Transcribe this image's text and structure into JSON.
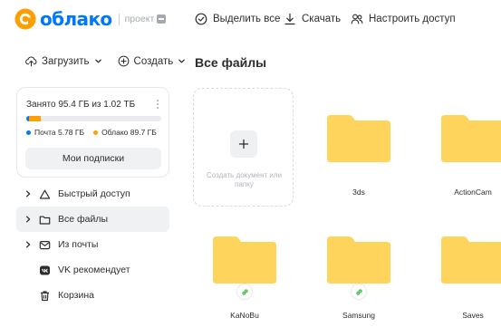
{
  "brand": {
    "name": "облако",
    "subtitle": "проект",
    "color": "#0077ff"
  },
  "toolbar": {
    "select_all": "Выделить все",
    "download": "Скачать",
    "access": "Настроить доступ"
  },
  "sidebar": {
    "upload_label": "Загрузить",
    "create_label": "Создать",
    "storage": {
      "used_label": "Занято 95.4 ГБ из 1.02 ТБ",
      "mail_label": "Почта 5.78 ГБ",
      "cloud_label": "Облако 89.7 ГБ",
      "mail_color": "#0077ff",
      "cloud_color": "#ffa000",
      "mail_fraction": 0.0055,
      "cloud_fraction": 0.086,
      "subscriptions_button": "Мои подписки"
    },
    "nav": [
      {
        "label": "Быстрый доступ",
        "icon": "triangle-icon",
        "expandable": true,
        "active": false
      },
      {
        "label": "Все файлы",
        "icon": "folder-icon",
        "expandable": true,
        "active": true
      },
      {
        "label": "Из почты",
        "icon": "mail-icon",
        "expandable": true,
        "active": false
      },
      {
        "label": "VK рекомендует",
        "icon": "vk-icon",
        "expandable": false,
        "active": false
      },
      {
        "label": "Корзина",
        "icon": "trash-icon",
        "expandable": false,
        "active": false
      }
    ]
  },
  "main": {
    "title": "Все файлы",
    "create_tile_label": "Создать документ или папку",
    "folder_color": "#ffd45c",
    "folders": [
      {
        "name": "3ds",
        "shared": false
      },
      {
        "name": "ActionCam",
        "shared": false
      },
      {
        "name": "KaNoBu",
        "shared": true
      },
      {
        "name": "Samsung",
        "shared": true
      },
      {
        "name": "Saves",
        "shared": false
      }
    ]
  }
}
